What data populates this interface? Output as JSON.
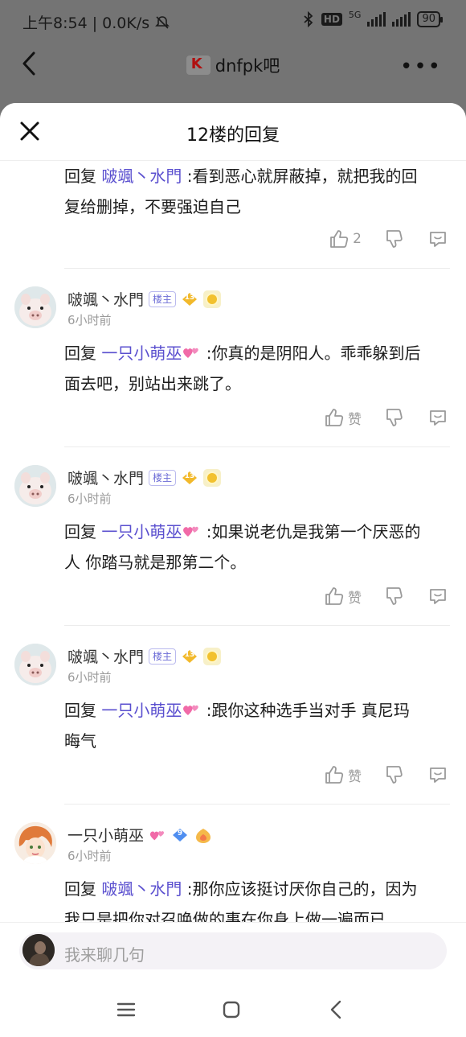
{
  "status_bar": {
    "time": "上午8:54",
    "speed": "0.0K/s",
    "hd_badge": "HD",
    "network": "5G",
    "battery": "90"
  },
  "background_page": {
    "forum_name": "dnfpk吧"
  },
  "sheet": {
    "title": "12楼的回复"
  },
  "replies": [
    {
      "partial": true,
      "reply_prefix": "回复",
      "mention": "啵颯丶水門",
      "text_line1": ":看到恶心就屏蔽掉，就把我的回",
      "text_line2": "复给删掉，不要强迫自己",
      "like_label": "2"
    },
    {
      "username": "啵颯丶水門",
      "op_tag": "楼主",
      "level": "13",
      "time": "6小时前",
      "reply_prefix": "回复",
      "mention": "一只小萌巫",
      "text_line1": ":你真的是阴阳人。乖乖躲到后",
      "text_line2": "面去吧，别站出来跳了。",
      "like_label": "赞"
    },
    {
      "username": "啵颯丶水門",
      "op_tag": "楼主",
      "level": "13",
      "time": "6小时前",
      "reply_prefix": "回复",
      "mention": "一只小萌巫",
      "text_line1": ":如果说老仇是我第一个厌恶的",
      "text_line2": "人 你踏马就是那第二个。",
      "like_label": "赞"
    },
    {
      "username": "啵颯丶水門",
      "op_tag": "楼主",
      "level": "13",
      "time": "6小时前",
      "reply_prefix": "回复",
      "mention": "一只小萌巫",
      "text_line1": ":跟你这种选手当对手 真尼玛",
      "text_line2": "晦气",
      "like_label": "赞"
    },
    {
      "username": "一只小萌巫",
      "level": "9",
      "time": "6小时前",
      "reply_prefix": "回复",
      "mention": "啵颯丶水門",
      "text_line1": ":那你应该挺讨厌你自己的，因为",
      "text_line2": "我只是把你对召唤做的事在你身上做一遍而已"
    }
  ],
  "composer": {
    "placeholder": "我来聊几句"
  },
  "colors": {
    "mention": "#5a4fcf",
    "op_tag": "#6b6bd6",
    "muted": "#9a9a9a"
  }
}
